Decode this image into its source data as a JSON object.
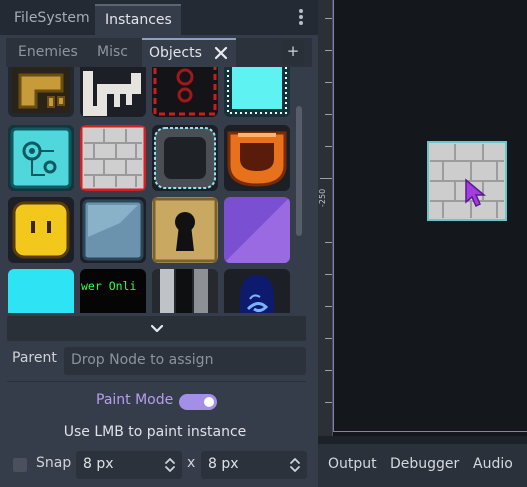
{
  "dock": {
    "tabs": [
      "FileSystem",
      "Instances"
    ],
    "active_tab": "Instances",
    "sub_tabs": [
      "Enemies",
      "Misc",
      "Objects"
    ],
    "active_sub_tab": "Objects",
    "add_tab_label": "+",
    "menu_icon": "vertical-ellipsis-icon",
    "close_icon": "close-icon"
  },
  "palette": {
    "tiles": [
      {
        "name": "key-pipe"
      },
      {
        "name": "skeleton-key"
      },
      {
        "name": "red-trap-crate"
      },
      {
        "name": "cyan-dotted-block"
      },
      {
        "name": "cyan-circuit-block"
      },
      {
        "name": "stone-brick-red-outline"
      },
      {
        "name": "dark-metal-frame"
      },
      {
        "name": "orange-pot"
      },
      {
        "name": "yellow-face-block"
      },
      {
        "name": "blue-ice-block"
      },
      {
        "name": "keyhole-lock"
      },
      {
        "name": "purple-slope"
      },
      {
        "name": "cyan-block"
      },
      {
        "name": "power-online-sign"
      },
      {
        "name": "stone-pillar"
      },
      {
        "name": "blue-portal"
      }
    ],
    "sign_text": "wer Onli",
    "expand_icon": "chevron-down-icon"
  },
  "settings": {
    "parent_label": "Parent",
    "parent_placeholder": "Drop Node to assign",
    "paint_mode_label": "Paint Mode",
    "paint_mode_on": true,
    "hint": "Use LMB to paint instance",
    "snap_label": "Snap",
    "snap_checked": false,
    "snap_x": "8 px",
    "snap_separator": "x",
    "snap_y": "8 px"
  },
  "viewport": {
    "ruler_label": "-250",
    "cursor_icon": "pointer-cursor-icon",
    "placed_instance": "stone-brick-block"
  },
  "bottom_panel": {
    "tabs": [
      "Output",
      "Debugger",
      "Audio"
    ]
  },
  "colors": {
    "accent": "#a48fe8",
    "paint_label": "#b79ef0",
    "dock_bg": "#363d4a",
    "viewport_bg": "#14171c"
  }
}
